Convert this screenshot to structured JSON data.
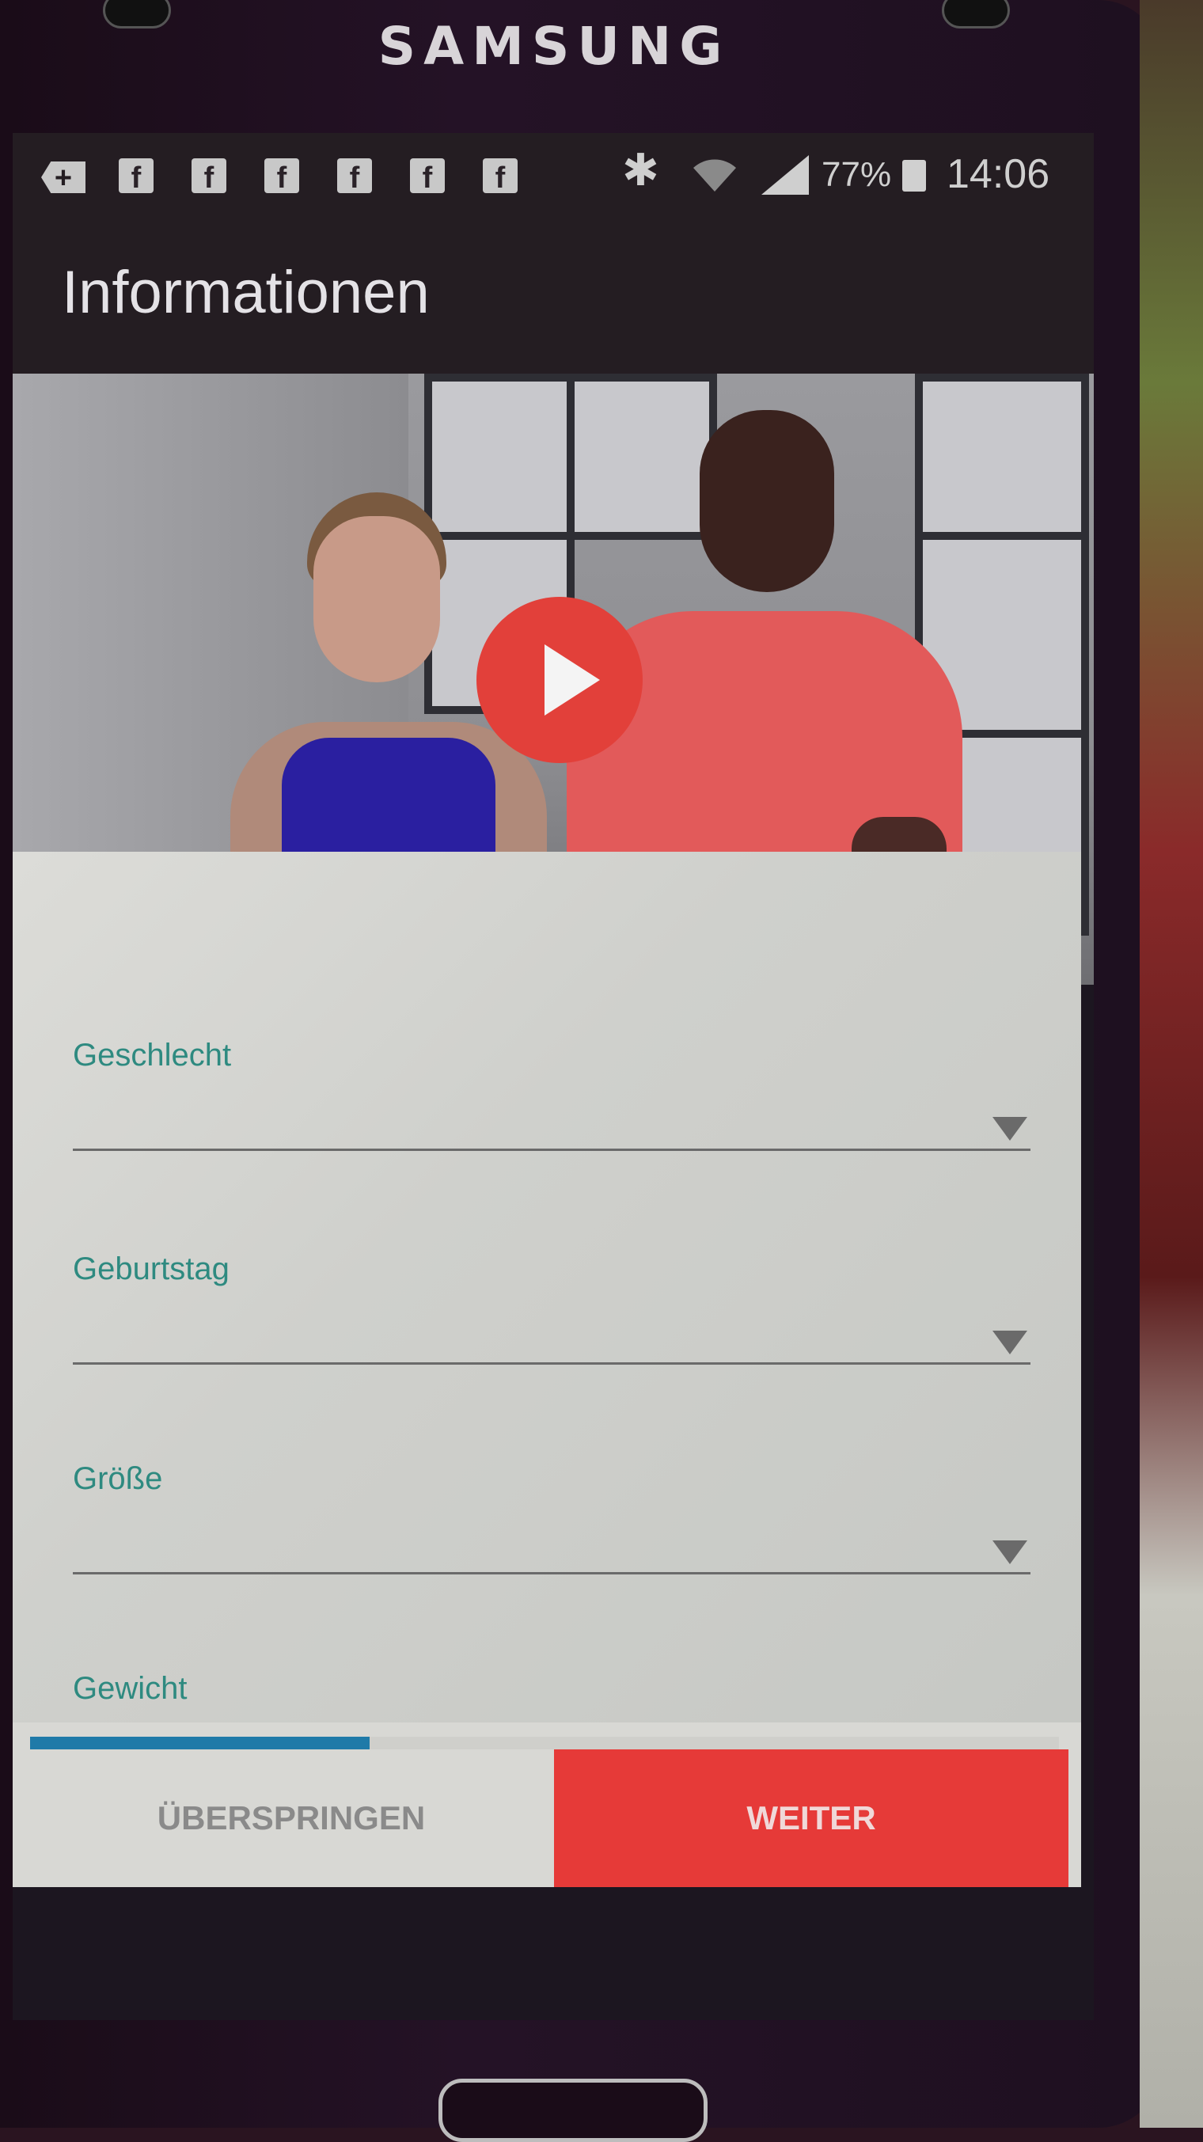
{
  "device": {
    "brand": "SAMSUNG"
  },
  "statusbar": {
    "notifications": [
      "plus-icon",
      "facebook-icon",
      "facebook-icon",
      "facebook-icon",
      "facebook-icon",
      "facebook-icon",
      "facebook-icon"
    ],
    "battery": "77%",
    "time": "14:06"
  },
  "appbar": {
    "title": "Informationen"
  },
  "video": {
    "play_icon": "play-icon"
  },
  "form": {
    "fields": [
      {
        "label": "Geschlecht"
      },
      {
        "label": "Geburtstag"
      },
      {
        "label": "Größe"
      },
      {
        "label": "Gewicht"
      }
    ]
  },
  "progress": {
    "fraction": 0.33
  },
  "footer": {
    "skip_label": "ÜBERSPRINGEN",
    "next_label": "WEITER"
  },
  "colors": {
    "accent": "#e63a38",
    "label": "#2e8a80",
    "progress": "#1f7aa8"
  }
}
